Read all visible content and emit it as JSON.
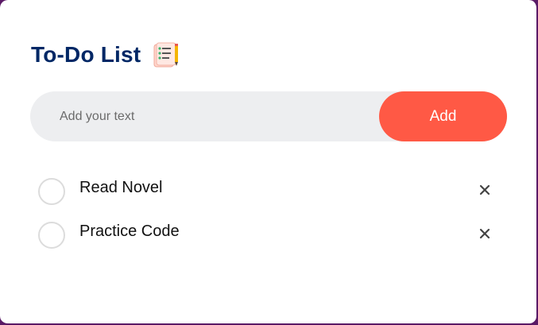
{
  "app": {
    "title": "To-Do List",
    "title_icon": "notepad-icon",
    "title_color": "#002765",
    "accent_color": "#ff5945",
    "frame_color": "#5a1a66"
  },
  "input": {
    "placeholder": "Add your text",
    "value": "",
    "add_label": "Add"
  },
  "tasks": [
    {
      "label": "Read Novel",
      "checked": false,
      "remove_icon": "close-icon"
    },
    {
      "label": "Practice Code",
      "checked": false,
      "remove_icon": "close-icon"
    }
  ]
}
